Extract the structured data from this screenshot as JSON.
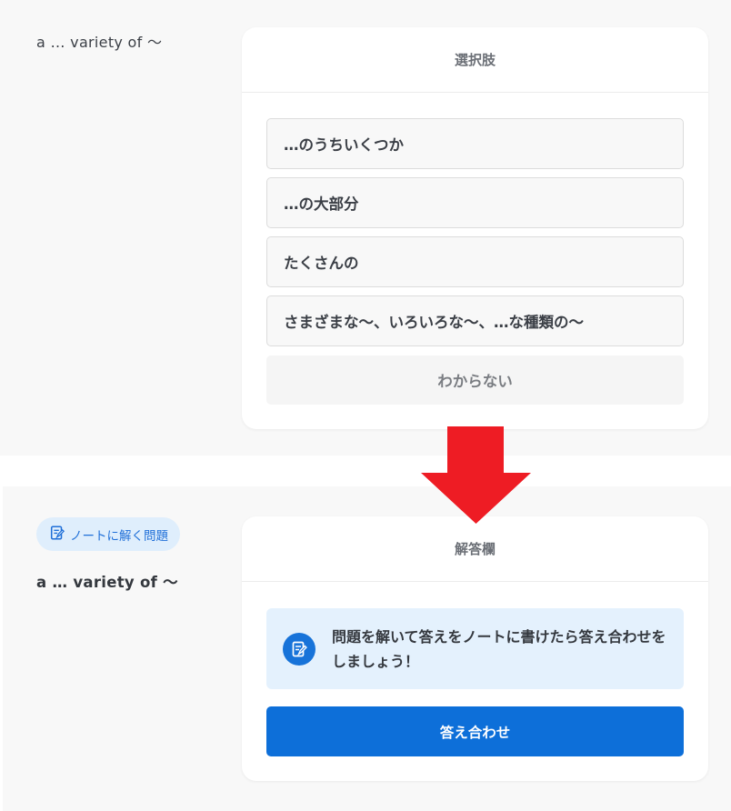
{
  "top_section": {
    "prompt": "a … variety of 〜",
    "choices_card": {
      "header": "選択肢",
      "options": [
        "…のうちいくつか",
        "…の大部分",
        "たくさんの",
        "さまざまな〜、いろいろな〜、…な種類の〜"
      ],
      "unknown_label": "わからない"
    }
  },
  "bottom_section": {
    "badge_label": "ノートに解く問題",
    "badge_icon": "note-check-icon",
    "prompt": "a … variety of 〜",
    "answer_card": {
      "header": "解答欄",
      "notice_icon": "note-check-icon",
      "notice_text": "問題を解いて答えをノートに書けたら答え合わせをしましょう！",
      "check_button_label": "答え合わせ"
    }
  },
  "colors": {
    "accent": "#0d6fd9",
    "badge_bg": "#dfeefc",
    "notice_bg": "#e4f1fd",
    "arrow": "#ee1c24"
  }
}
